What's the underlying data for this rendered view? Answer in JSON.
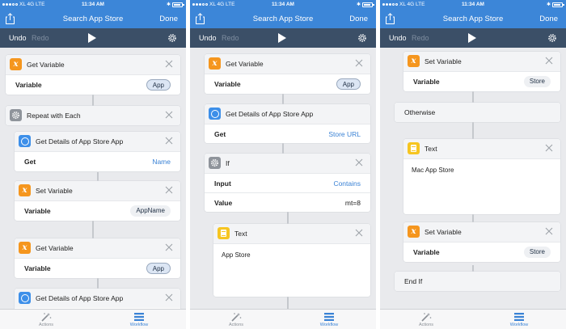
{
  "status": {
    "carrier": "XL 4G LTE",
    "time": "11:34 AM"
  },
  "nav": {
    "title": "Search App Store",
    "done": "Done"
  },
  "toolbar": {
    "undo": "Undo",
    "redo": "Redo"
  },
  "tabs": {
    "actions": "Actions",
    "workflow": "Workflow"
  },
  "colors": {
    "nav_blue": "#3c86d8",
    "toolbar_dark": "#3b4f67",
    "accent_blue": "#3a82d5",
    "variable_orange": "#f5961e",
    "text_yellow": "#f6c521"
  },
  "screens": [
    {
      "cards": [
        {
          "title": "Get Variable",
          "icon": "variable-icon",
          "rows": [
            {
              "label": "Variable",
              "value": "App",
              "type": "pill"
            }
          ]
        },
        {
          "title": "Repeat with Each",
          "icon": "gear-icon"
        },
        {
          "title": "Get Details of App Store App",
          "icon": "app-store-icon",
          "rows": [
            {
              "label": "Get",
              "value": "Name",
              "type": "blue"
            }
          ]
        },
        {
          "title": "Set Variable",
          "icon": "variable-icon",
          "rows": [
            {
              "label": "Variable",
              "value": "AppName",
              "type": "pill-gray"
            }
          ]
        },
        {
          "title": "Get Variable",
          "icon": "variable-icon",
          "rows": [
            {
              "label": "Variable",
              "value": "App",
              "type": "pill"
            }
          ]
        },
        {
          "title": "Get Details of App Store App",
          "icon": "app-store-icon"
        }
      ]
    },
    {
      "cards": [
        {
          "title": "Get Variable",
          "icon": "variable-icon",
          "rows": [
            {
              "label": "Variable",
              "value": "App",
              "type": "pill"
            }
          ]
        },
        {
          "title": "Get Details of App Store App",
          "icon": "app-store-icon",
          "rows": [
            {
              "label": "Get",
              "value": "Store URL",
              "type": "blue"
            }
          ]
        },
        {
          "title": "If",
          "icon": "gear-icon",
          "rows": [
            {
              "label": "Input",
              "value": "Contains",
              "type": "blue"
            },
            {
              "label": "Value",
              "value": "mt=8",
              "type": "plain"
            }
          ]
        },
        {
          "title": "Text",
          "icon": "text-icon",
          "body": "App Store"
        }
      ]
    },
    {
      "cards": [
        {
          "title": "Set Variable",
          "icon": "variable-icon",
          "rows": [
            {
              "label": "Variable",
              "value": "Store",
              "type": "pill-gray"
            }
          ]
        },
        {
          "title": "Otherwise"
        },
        {
          "title": "Text",
          "icon": "text-icon",
          "body": "Mac App Store"
        },
        {
          "title": "Set Variable",
          "icon": "variable-icon",
          "rows": [
            {
              "label": "Variable",
              "value": "Store",
              "type": "pill-gray"
            }
          ]
        },
        {
          "title": "End If"
        }
      ]
    }
  ]
}
